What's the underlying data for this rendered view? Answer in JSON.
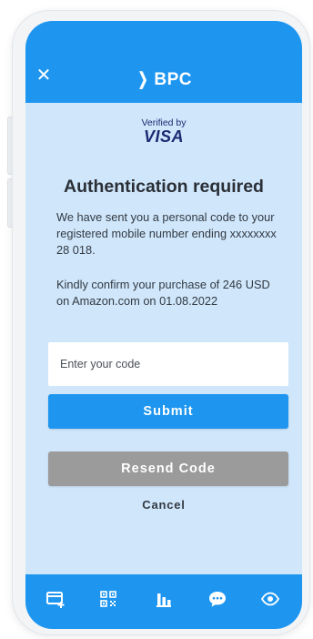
{
  "header": {
    "brand": "BPC",
    "close_icon": "close-icon"
  },
  "verification": {
    "verified_by": "Verified by",
    "visa": "VISA"
  },
  "main": {
    "title": "Authentication required",
    "message_sent": "We have sent you a personal code to your registered mobile number ending xxxxxxxx 28 018.",
    "message_confirm": "Kindly confirm your purchase of 246 USD on Amazon.com on 01.08.2022"
  },
  "form": {
    "code_placeholder": "Enter your code",
    "code_value": "",
    "submit_label": "Submit",
    "resend_label": "Resend Code",
    "cancel_label": "Cancel"
  },
  "bottom_nav": {
    "icons": [
      "card-add-icon",
      "qr-code-icon",
      "bar-chart-icon",
      "chat-icon",
      "eye-icon"
    ]
  },
  "colors": {
    "primary": "#1e96f0",
    "background": "#cfe6fb",
    "resend": "#9b9b9b",
    "visa": "#1b2a73",
    "text": "#2b2f36"
  }
}
